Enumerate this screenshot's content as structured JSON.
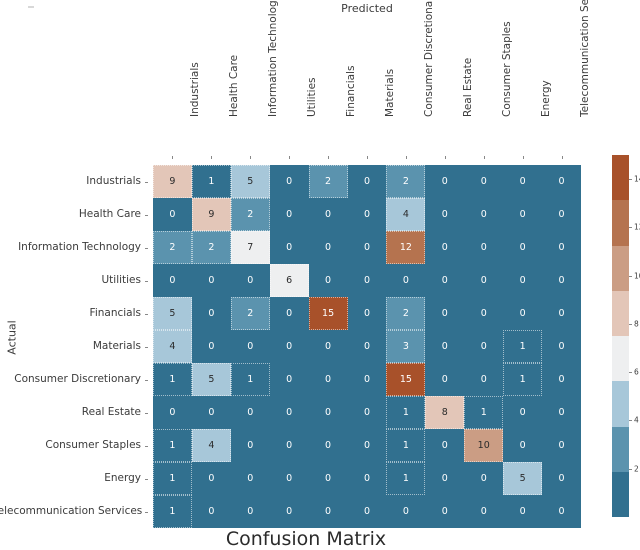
{
  "title": "Confusion Matrix",
  "axes": {
    "x_title": "Predicted",
    "y_title": "Actual"
  },
  "chart_data": {
    "type": "heatmap",
    "title": "Confusion Matrix",
    "xlabel": "Predicted",
    "ylabel": "Actual",
    "categories": [
      "Industrials",
      "Health Care",
      "Information Technology",
      "Utilities",
      "Financials",
      "Materials",
      "Consumer Discretionary",
      "Real Estate",
      "Consumer Staples",
      "Energy",
      "Telecommunication Services"
    ],
    "x_ticklabels": [
      "Industrials",
      "Health Care",
      "Information Technology",
      "Utilities",
      "Financials",
      "Materials",
      "Consumer Discretionary",
      "Real Estate",
      "Consumer Staples",
      "Energy",
      "Telecommunication Services"
    ],
    "y_ticklabels": [
      "Industrials",
      "Health Care",
      "Information Technology",
      "Utilities",
      "Financials",
      "Materials",
      "Consumer Discretionary",
      "Real Estate",
      "Consumer Staples",
      "Energy",
      "Telecommunication Services"
    ],
    "values": [
      [
        9,
        1,
        5,
        0,
        2,
        0,
        2,
        0,
        0,
        0,
        0
      ],
      [
        0,
        9,
        2,
        0,
        0,
        0,
        4,
        0,
        0,
        0,
        0
      ],
      [
        2,
        2,
        7,
        0,
        0,
        0,
        12,
        0,
        0,
        0,
        0
      ],
      [
        0,
        0,
        0,
        6,
        0,
        0,
        0,
        0,
        0,
        0,
        0
      ],
      [
        5,
        0,
        2,
        0,
        15,
        0,
        2,
        0,
        0,
        0,
        0
      ],
      [
        4,
        0,
        0,
        0,
        0,
        0,
        3,
        0,
        0,
        1,
        0
      ],
      [
        1,
        5,
        1,
        0,
        0,
        0,
        15,
        0,
        0,
        1,
        0
      ],
      [
        0,
        0,
        0,
        0,
        0,
        0,
        1,
        8,
        1,
        0,
        0
      ],
      [
        1,
        4,
        0,
        0,
        0,
        0,
        1,
        0,
        10,
        0,
        0
      ],
      [
        1,
        0,
        0,
        0,
        0,
        0,
        1,
        0,
        0,
        5,
        0
      ],
      [
        1,
        0,
        0,
        0,
        0,
        0,
        0,
        0,
        0,
        0,
        0
      ]
    ],
    "annotate": true,
    "colormap": "RdBu_r-discrete",
    "colorbar": {
      "ticks": [
        2,
        4,
        6,
        8,
        10,
        12,
        14
      ],
      "tick_labels": [
        "2",
        "4",
        "6",
        "8",
        "10",
        "12",
        "14"
      ],
      "vmin": 0,
      "vmax": 15,
      "position": "right",
      "discrete_levels": 8,
      "level_colors": [
        "#31708f",
        "#5b93ae",
        "#a7c7d9",
        "#eeeff0",
        "#e3c6b8",
        "#cb9d84",
        "#b5734f",
        "#a8512a"
      ]
    },
    "grid": false
  },
  "colors": {
    "c0": "#31708f",
    "c1": "#5b93ae",
    "c2": "#a7c7d9",
    "c3": "#d3e1e9",
    "c4": "#eeeff0",
    "c5": "#e3c6b8",
    "c6": "#cb9d84",
    "c7": "#b5734f",
    "c8": "#a8512a",
    "text_dark": "#2b2b2b",
    "text_light": "#ffffff",
    "axis": "#3b3b3b"
  }
}
